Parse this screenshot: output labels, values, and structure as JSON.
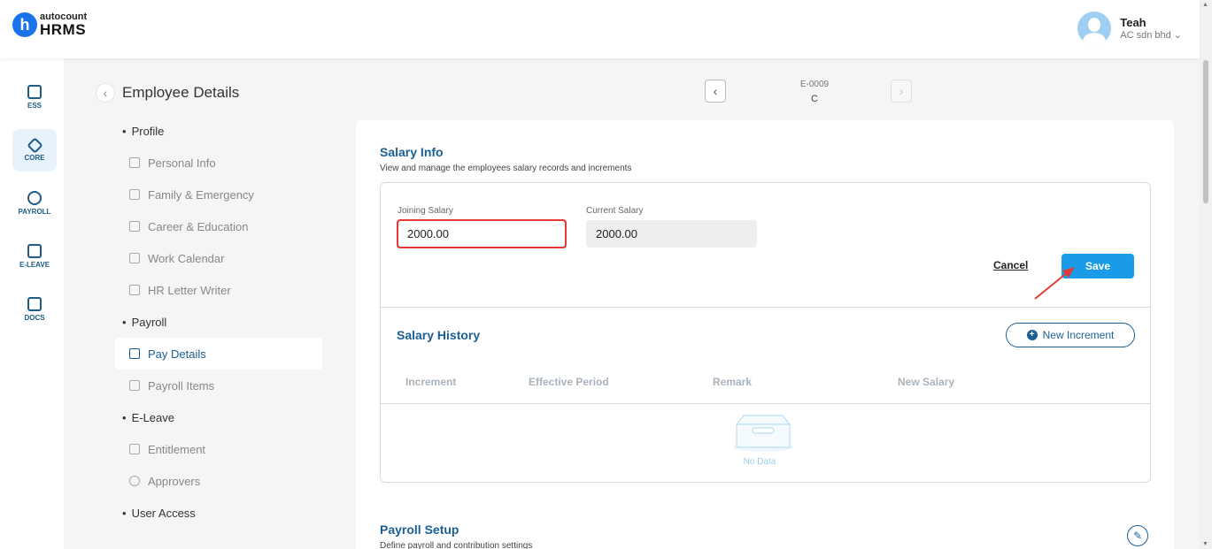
{
  "brand": {
    "small": "autocount",
    "big": "HRMS"
  },
  "user": {
    "name": "Teah",
    "company": "AC sdn bhd ⌄"
  },
  "rail": [
    {
      "label": "ESS"
    },
    {
      "label": "CORE"
    },
    {
      "label": "PAYROLL"
    },
    {
      "label": "E-LEAVE"
    },
    {
      "label": "DOCS"
    }
  ],
  "page": {
    "title": "Employee Details"
  },
  "nav": {
    "profile": "Profile",
    "personal_info": "Personal Info",
    "family": "Family & Emergency",
    "career": "Career & Education",
    "work_calendar": "Work Calendar",
    "hr_letter": "HR Letter Writer",
    "payroll": "Payroll",
    "pay_details": "Pay Details",
    "payroll_items": "Payroll Items",
    "eleave": "E-Leave",
    "entitlement": "Entitlement",
    "approvers": "Approvers",
    "user_access": "User Access"
  },
  "record": {
    "code": "E-0009",
    "name": "C"
  },
  "salary_info": {
    "title": "Salary Info",
    "subtitle": "View and manage the employees salary records and increments",
    "joining_label": "Joining Salary",
    "joining_value": "2000.00",
    "current_label": "Current Salary",
    "current_value": "2000.00",
    "cancel": "Cancel",
    "save": "Save"
  },
  "salary_history": {
    "title": "Salary History",
    "new_increment": "New Increment",
    "columns": [
      "Increment",
      "Effective Period",
      "Remark",
      "New Salary"
    ],
    "empty": "No Data"
  },
  "payroll_setup": {
    "title": "Payroll Setup",
    "subtitle": "Define payroll and contribution settings"
  },
  "colors": {
    "accent": "#1a5f96",
    "button": "#1a9be8",
    "highlight": "#e53935"
  }
}
